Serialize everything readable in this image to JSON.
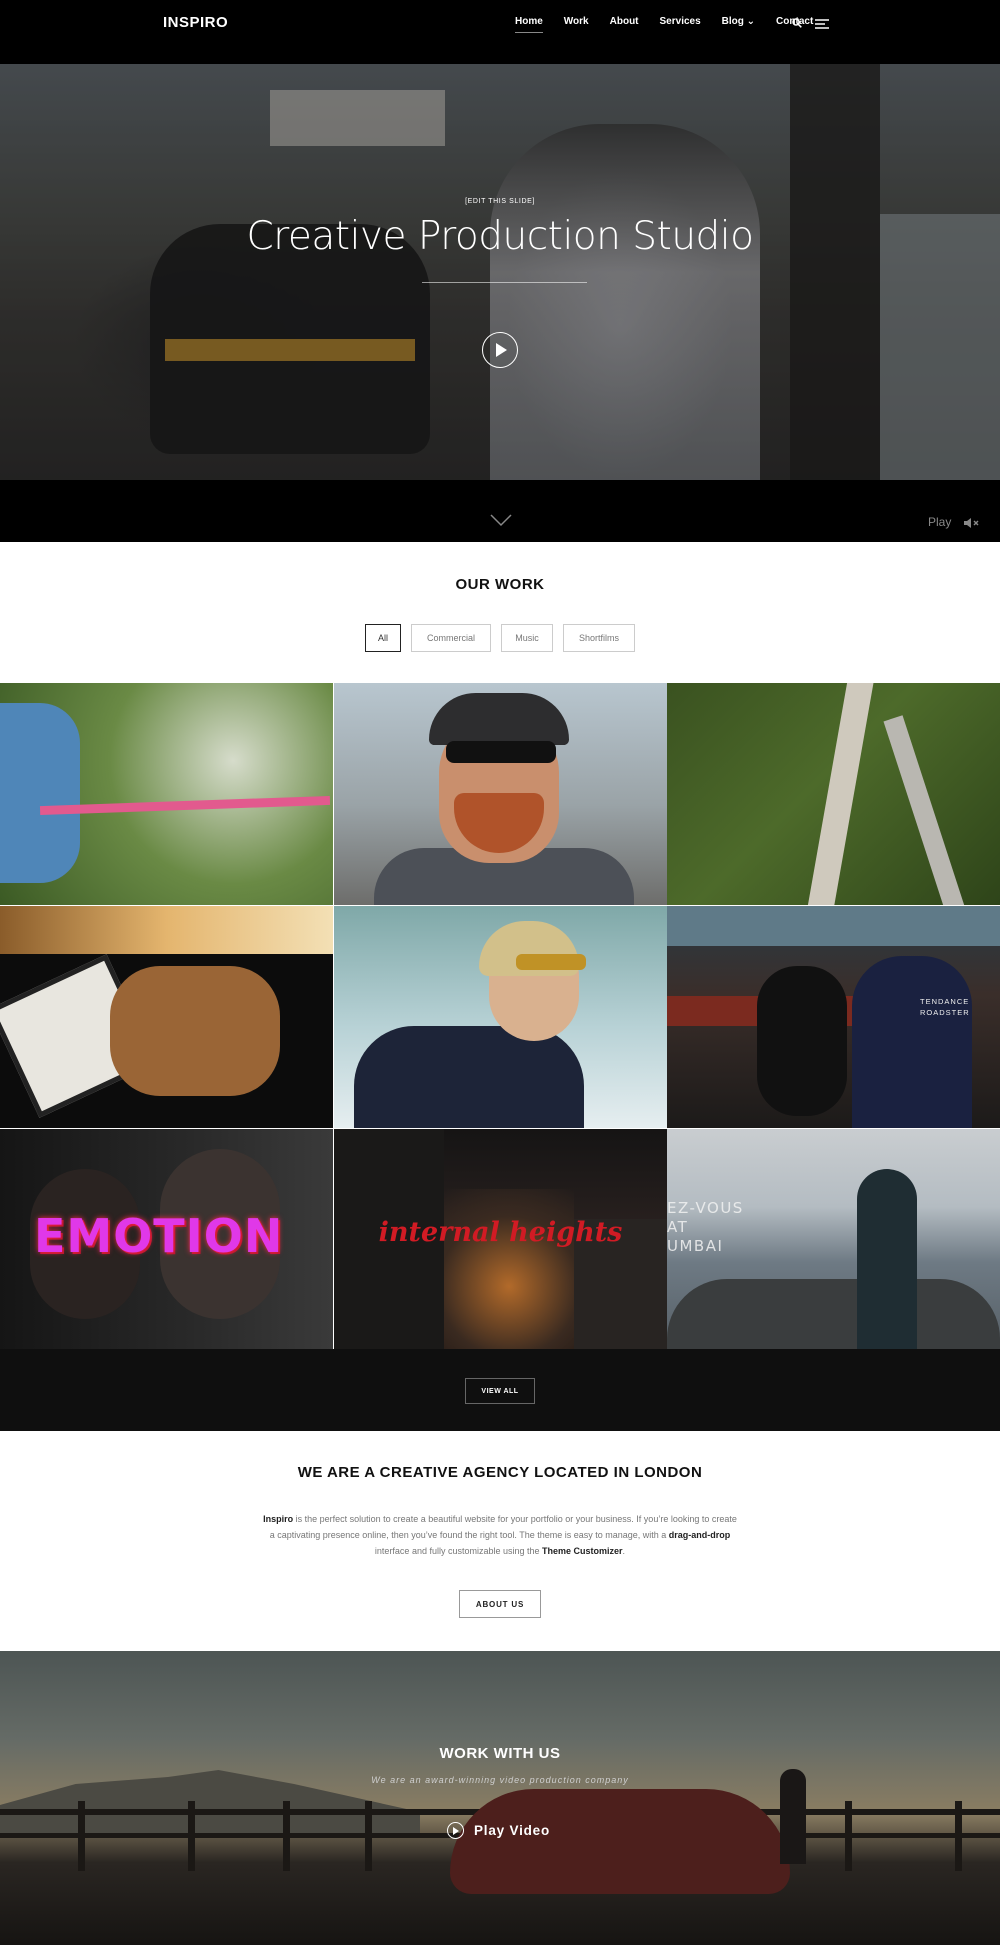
{
  "header": {
    "logo": "INSPIRO",
    "nav": [
      {
        "label": "Home",
        "active": true
      },
      {
        "label": "Work"
      },
      {
        "label": "About"
      },
      {
        "label": "Services"
      },
      {
        "label": "Blog ⌄"
      },
      {
        "label": "Contact"
      }
    ],
    "icons": [
      "search-icon",
      "menu-icon"
    ]
  },
  "hero": {
    "edit_label": "[EDIT THIS SLIDE]",
    "title": "Creative Production Studio",
    "play_label": "Play",
    "icons": [
      "play-icon",
      "chevron-down-icon",
      "mute-icon"
    ]
  },
  "work": {
    "title": "OUR WORK",
    "filters": [
      "All",
      "Commercial",
      "Music",
      "Shortfilms"
    ],
    "active_filter": "All",
    "tiles": [
      {
        "overlay": ""
      },
      {
        "overlay": ""
      },
      {
        "overlay": ""
      },
      {
        "overlay": ""
      },
      {
        "overlay": ""
      },
      {
        "overlay": "TENDANCE\nROADSTER"
      },
      {
        "overlay": "EMOTION"
      },
      {
        "overlay": "internal heights"
      },
      {
        "overlay": "EZ-VOUS\nAT\nUMBAI"
      }
    ],
    "view_all": "VIEW ALL"
  },
  "agency": {
    "title": "WE ARE A CREATIVE AGENCY LOCATED IN LONDON",
    "brand": "Inspiro",
    "text_1": " is the perfect solution to create a beautiful website for your portfolio or your business. If you’re looking to create a captivating presence online, then you’ve found the right tool. The theme is easy to manage, with a ",
    "drag_drop": "drag-and-drop",
    "text_2": " interface and fully customizable using the ",
    "customizer": "Theme Customizer",
    "text_3": ".",
    "button": "ABOUT US"
  },
  "work_with_us": {
    "title": "WORK WITH US",
    "subtitle": "We are an award-winning video production company",
    "play_video": "Play Video"
  },
  "colors": {
    "header_bg": "#000000",
    "dark_band": "#0f0f0f",
    "text_dark": "#111111",
    "emotion_accent": "#e038e8",
    "internal_accent": "#d11b24"
  }
}
